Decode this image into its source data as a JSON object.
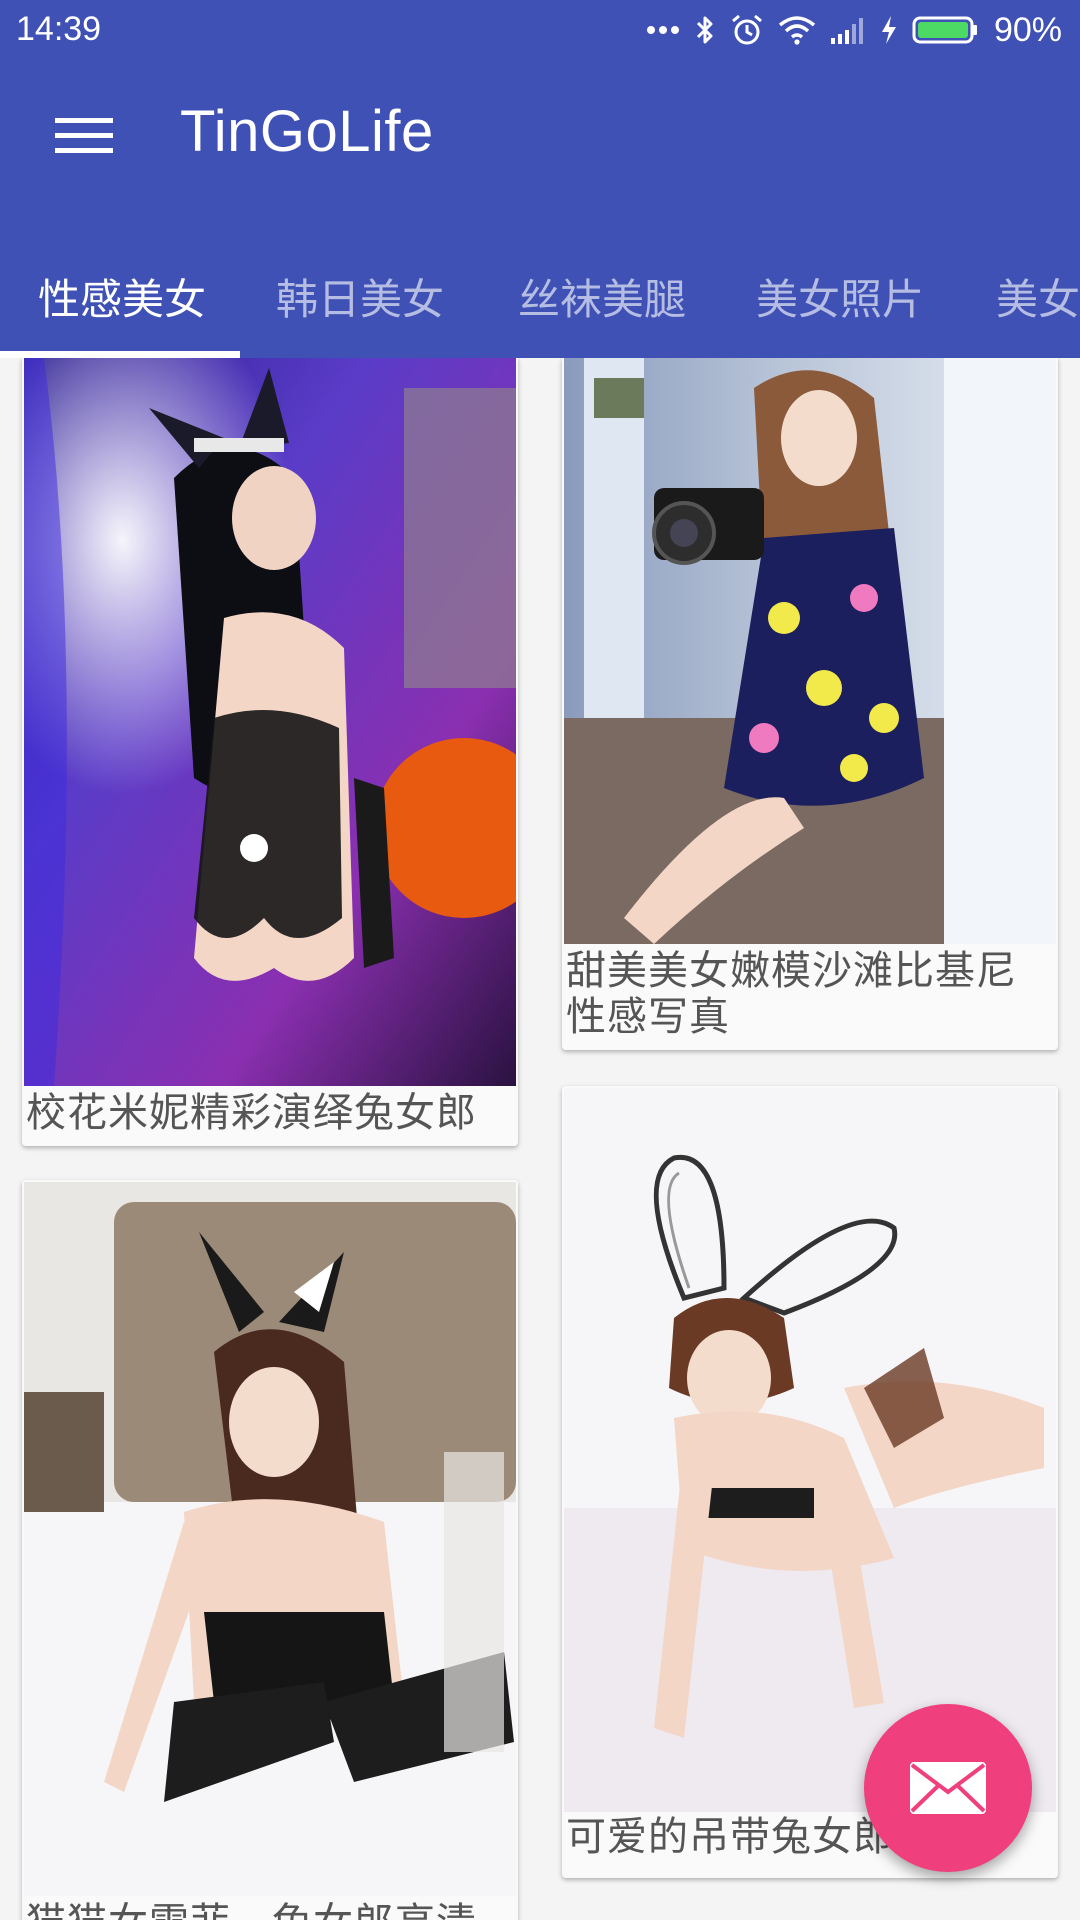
{
  "status_bar": {
    "time": "14:39",
    "battery": "90%",
    "icons": [
      "more-dots-icon",
      "bluetooth-icon",
      "alarm-icon",
      "wifi-icon",
      "signal-icon",
      "charging-icon",
      "battery-icon"
    ]
  },
  "app": {
    "title": "TinGoLife",
    "colors": {
      "primary": "#3f51b5",
      "accent": "#ef3f7c",
      "card": "#fafafa",
      "text": "#555555"
    }
  },
  "tabs": [
    {
      "label": "性感美女",
      "active": true
    },
    {
      "label": "韩日美女",
      "active": false
    },
    {
      "label": "丝袜美腿",
      "active": false
    },
    {
      "label": "美女照片",
      "active": false
    },
    {
      "label": "美女",
      "active": false
    }
  ],
  "cards": [
    {
      "title": "校花米妮精彩演绎兔女郎",
      "image": "woman in bunny ears and black lace bodysuit, purple curtain"
    },
    {
      "title": "甜美美女嫩模沙滩比基尼性感写真",
      "image": "woman in floral dress holding camera near window"
    },
    {
      "title": "猫猫女雪菲，兔女郎高清性感",
      "image": "woman in bunny ears on white bed, black stockings"
    },
    {
      "title": "可爱的吊带兔女郎",
      "image": "woman with lace bunny ears kneeling on white bed"
    }
  ],
  "fab": {
    "icon": "mail-icon"
  }
}
